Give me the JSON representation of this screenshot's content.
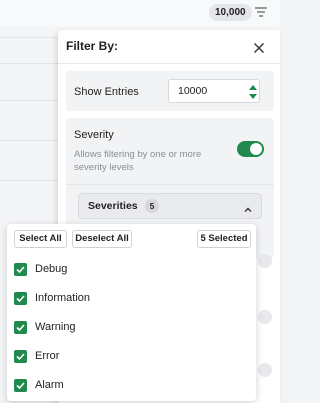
{
  "topbar": {
    "entries_badge": "10,000",
    "filter_icon": "filter-lines-icon"
  },
  "panel": {
    "title": "Filter By:",
    "close_icon": "close-icon",
    "show_entries": {
      "label": "Show Entries",
      "value": "10000"
    },
    "severity": {
      "title": "Severity",
      "description": "Allows filtering by one or more severity levels",
      "enabled": true,
      "dropdown_label": "Severities",
      "dropdown_count": "5"
    }
  },
  "popup": {
    "select_all": "Select All",
    "deselect_all": "Deselect All",
    "selected_count": "5 Selected",
    "options": [
      {
        "label": "Debug",
        "checked": true
      },
      {
        "label": "Information",
        "checked": true
      },
      {
        "label": "Warning",
        "checked": true
      },
      {
        "label": "Error",
        "checked": true
      },
      {
        "label": "Alarm",
        "checked": true
      }
    ]
  },
  "colors": {
    "accent_green": "#1f8a4c",
    "panel_bg": "#ffffff",
    "section_bg": "#f2f3f5"
  }
}
